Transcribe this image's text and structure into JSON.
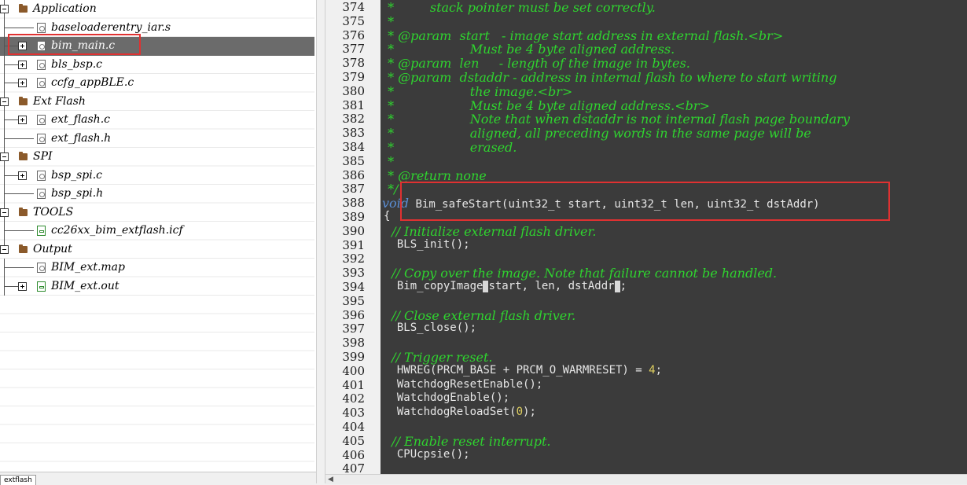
{
  "workspace": {
    "tree": [
      {
        "label": "Application",
        "kind": "folder"
      },
      {
        "label": "baseloaderentry_iar.s",
        "kind": "file"
      },
      {
        "label": "bim_main.c",
        "kind": "file",
        "selected": true
      },
      {
        "label": "bls_bsp.c",
        "kind": "file"
      },
      {
        "label": "ccfg_appBLE.c",
        "kind": "file"
      },
      {
        "label": "Ext Flash",
        "kind": "folder"
      },
      {
        "label": "ext_flash.c",
        "kind": "file"
      },
      {
        "label": "ext_flash.h",
        "kind": "file"
      },
      {
        "label": "SPI",
        "kind": "folder"
      },
      {
        "label": "bsp_spi.c",
        "kind": "file"
      },
      {
        "label": "bsp_spi.h",
        "kind": "file"
      },
      {
        "label": "TOOLS",
        "kind": "folder"
      },
      {
        "label": "cc26xx_bim_extflash.icf",
        "kind": "file"
      },
      {
        "label": "Output",
        "kind": "folder"
      },
      {
        "label": "BIM_ext.map",
        "kind": "file"
      },
      {
        "label": "BIM_ext.out",
        "kind": "file"
      }
    ],
    "tab_label": "extflash"
  },
  "editor": {
    "lines": [
      {
        "no": "374",
        "segs": [
          {
            "t": "com",
            "s": " *         stack pointer must be set correctly."
          }
        ]
      },
      {
        "no": "375",
        "segs": [
          {
            "t": "com",
            "s": " *"
          }
        ]
      },
      {
        "no": "376",
        "segs": [
          {
            "t": "com",
            "s": " * @param  start   - image start address in external flash.<br>"
          }
        ]
      },
      {
        "no": "377",
        "segs": [
          {
            "t": "com",
            "s": " *                   Must be 4 byte aligned address."
          }
        ]
      },
      {
        "no": "378",
        "segs": [
          {
            "t": "com",
            "s": " * @param  len     - length of the image in bytes."
          }
        ]
      },
      {
        "no": "379",
        "segs": [
          {
            "t": "com",
            "s": " * @param  dstaddr - address in internal flash to where to start writing"
          }
        ]
      },
      {
        "no": "380",
        "segs": [
          {
            "t": "com",
            "s": " *                   the image.<br>"
          }
        ]
      },
      {
        "no": "381",
        "segs": [
          {
            "t": "com",
            "s": " *                   Must be 4 byte aligned address.<br>"
          }
        ]
      },
      {
        "no": "382",
        "segs": [
          {
            "t": "com",
            "s": " *                   Note that when dstaddr is not internal flash page boundary"
          }
        ]
      },
      {
        "no": "383",
        "segs": [
          {
            "t": "com",
            "s": " *                   aligned, all preceding words in the same page will be"
          }
        ]
      },
      {
        "no": "384",
        "segs": [
          {
            "t": "com",
            "s": " *                   erased."
          }
        ]
      },
      {
        "no": "385",
        "segs": [
          {
            "t": "com",
            "s": " *"
          }
        ]
      },
      {
        "no": "386",
        "segs": [
          {
            "t": "com",
            "s": " * @return none"
          }
        ]
      },
      {
        "no": "387",
        "segs": [
          {
            "t": "com",
            "s": " */"
          }
        ]
      },
      {
        "no": "388",
        "segs": [
          {
            "t": "kw",
            "s": "void"
          },
          {
            "t": "code",
            "s": " Bim_safeStart(uint32_t start, uint32_t len, uint32_t dstAddr)"
          }
        ]
      },
      {
        "no": "389",
        "segs": [
          {
            "t": "code",
            "s": "{"
          }
        ]
      },
      {
        "no": "390",
        "segs": [
          {
            "t": "com",
            "s": "  // Initialize external flash driver."
          }
        ]
      },
      {
        "no": "391",
        "segs": [
          {
            "t": "code",
            "s": "  BLS_init();"
          }
        ]
      },
      {
        "no": "392",
        "segs": []
      },
      {
        "no": "393",
        "segs": [
          {
            "t": "com",
            "s": "  // Copy over the image. Note that failure cannot be handled."
          }
        ]
      },
      {
        "no": "394",
        "segs": [
          {
            "t": "code",
            "s": "  Bim_copyImage"
          },
          {
            "t": "caret",
            "s": ""
          },
          {
            "t": "code",
            "s": "start, len, dstAddr"
          },
          {
            "t": "caret",
            "s": ""
          },
          {
            "t": "code",
            "s": ";"
          }
        ]
      },
      {
        "no": "395",
        "segs": []
      },
      {
        "no": "396",
        "segs": [
          {
            "t": "com",
            "s": "  // Close external flash driver."
          }
        ]
      },
      {
        "no": "397",
        "segs": [
          {
            "t": "code",
            "s": "  BLS_close();"
          }
        ]
      },
      {
        "no": "398",
        "segs": []
      },
      {
        "no": "399",
        "segs": [
          {
            "t": "com",
            "s": "  // Trigger reset."
          }
        ]
      },
      {
        "no": "400",
        "segs": [
          {
            "t": "code",
            "s": "  HWREG(PRCM_BASE + PRCM_O_WARMRESET) = "
          },
          {
            "t": "num",
            "s": "4"
          },
          {
            "t": "code",
            "s": ";"
          }
        ]
      },
      {
        "no": "401",
        "segs": [
          {
            "t": "code",
            "s": "  WatchdogResetEnable();"
          }
        ]
      },
      {
        "no": "402",
        "segs": [
          {
            "t": "code",
            "s": "  WatchdogEnable();"
          }
        ]
      },
      {
        "no": "403",
        "segs": [
          {
            "t": "code",
            "s": "  WatchdogReloadSet("
          },
          {
            "t": "num",
            "s": "0"
          },
          {
            "t": "code",
            "s": ");"
          }
        ]
      },
      {
        "no": "404",
        "segs": []
      },
      {
        "no": "405",
        "segs": [
          {
            "t": "com",
            "s": "  // Enable reset interrupt."
          }
        ]
      },
      {
        "no": "406",
        "segs": [
          {
            "t": "code",
            "s": "  CPUcpsie();"
          }
        ]
      },
      {
        "no": "407",
        "segs": []
      }
    ]
  },
  "colors": {
    "editor_bg": "#3b3b3b",
    "comment": "#2fd42f",
    "code": "#e6e6e6",
    "keyword": "#5b8fd6",
    "number": "#e0d060",
    "highlight_box": "#e03131",
    "selected_row": "#6b6b6b"
  }
}
